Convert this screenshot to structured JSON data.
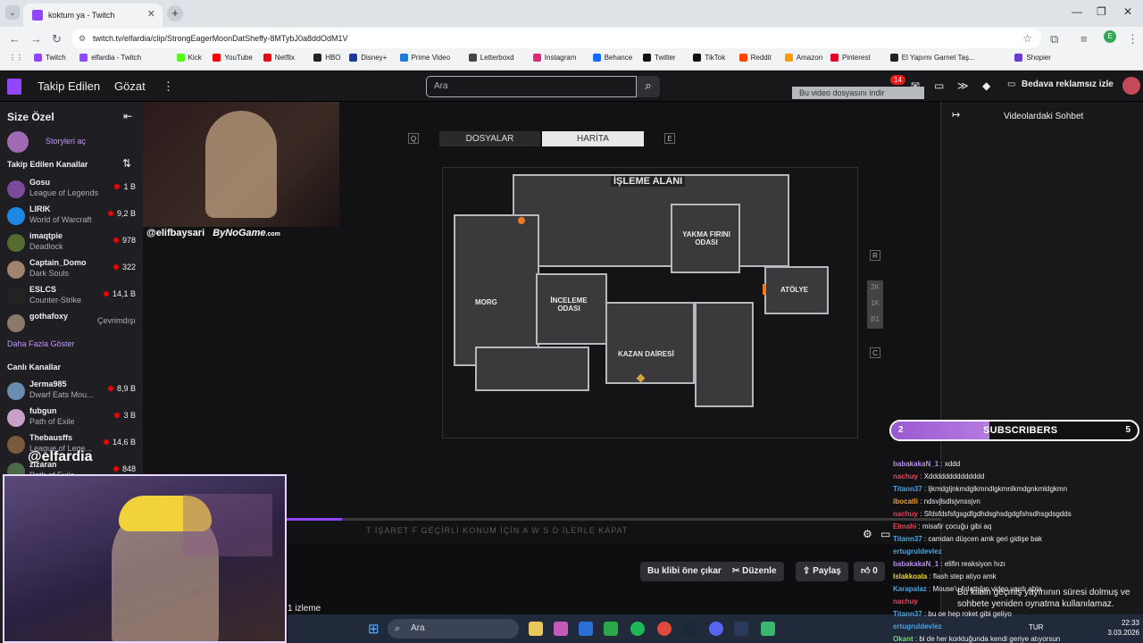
{
  "browser": {
    "tab_title": "koktum ya - Twitch",
    "url": "twitch.tv/elfardia/clip/StrongEagerMoonDatSheffy-8MTybJ0a8ddOdM1V",
    "bookmarks": [
      "Twitch",
      "elfardia - Twitch",
      "Kick",
      "YouTube",
      "Netflix",
      "HBO",
      "Disney+",
      "Prime Video",
      "Letterboxd",
      "Instagram",
      "Behance",
      "Twitter",
      "TikTok",
      "Reddit",
      "Amazon",
      "Pinterest",
      "El Yapımı Garnet Taş...",
      "Shopier"
    ],
    "bookmark_colors": [
      "#9146ff",
      "#9146ff",
      "#53fc18",
      "#ff0000",
      "#e50914",
      "#222222",
      "#1a3b9c",
      "#1f7ae0",
      "#444444",
      "#dd2a7b",
      "#1769ff",
      "#111111",
      "#111111",
      "#ff4500",
      "#ff9900",
      "#e60023",
      "#222222",
      "#6a3cd6"
    ],
    "profile_letter": "E"
  },
  "topnav": {
    "following": "Takip Edilen",
    "browse": "Gözat",
    "more": "⋮",
    "search_placeholder": "Ara",
    "notif_count": "14",
    "ad_free": "Bedava reklamsız izle"
  },
  "sidebar": {
    "for_you": "Size Özel",
    "stories": "Storyleri aç",
    "followed_title": "Takip Edilen Kanallar",
    "followed": [
      {
        "name": "Gosu",
        "game": "League of Legends",
        "viewers": "1 B",
        "color": "#7b4a9a"
      },
      {
        "name": "LIRIK",
        "game": "World of Warcraft",
        "viewers": "9,2 B",
        "color": "#1e88e5"
      },
      {
        "name": "imaqtpie",
        "game": "Deadlock",
        "viewers": "978",
        "color": "#556b2f"
      },
      {
        "name": "Captain_Domo",
        "game": "Dark Souls",
        "viewers": "322",
        "color": "#a0826d"
      },
      {
        "name": "ESLCS",
        "game": "Counter-Strike",
        "viewers": "14,1 B",
        "color": "#222222"
      },
      {
        "name": "gothafoxy",
        "game": "",
        "viewers": "",
        "status": "Çevrimdışı",
        "color": "#8a7a6a"
      }
    ],
    "show_more": "Daha Fazla Göster",
    "live_title": "Canlı Kanallar",
    "live": [
      {
        "name": "Jerma985",
        "game": "Dwarf Eats Mou...",
        "viewers": "8,9 B",
        "color": "#6a8caf"
      },
      {
        "name": "fubgun",
        "game": "Path of Exile",
        "viewers": "3 B",
        "color": "#c8a0c8"
      },
      {
        "name": "Thebausffs",
        "game": "League of Lege...",
        "viewers": "14,6 B",
        "color": "#7a5a3a"
      },
      {
        "name": "zizaran",
        "game": "Path of Exile",
        "viewers": "848",
        "color": "#4a6a4a"
      }
    ]
  },
  "game": {
    "tab_files": "DOSYALAR",
    "tab_map": "HARİTA",
    "key_left": "Q",
    "key_right": "E",
    "key_r": "R",
    "key_c": "C",
    "floors": [
      "2K",
      "1K",
      "B1"
    ],
    "rooms": {
      "processing": "İŞLEME ALANI",
      "furnace": "YAKMA FIRINI ODASI",
      "morgue": "MORG",
      "exam": "İNCELEME ODASI",
      "workshop": "ATÖLYE",
      "boiler": "KAZAN DAİRESİ"
    },
    "hints": "T İŞARET  F GEÇİRLİ KONUM İÇİN  A W S D İLERLE  KAPAT",
    "overlay_handle": "@elifbaysari",
    "overlay_brand": "ByNoGame",
    "overlay_domain": ".com"
  },
  "clip_actions": {
    "feature": "Bu klibi öne çıkar",
    "edit": "Düzenle",
    "share": "Paylaş",
    "likes": "0"
  },
  "views_text": "1 izleme",
  "download_notice": "Bu video dosyasını indir",
  "chat": {
    "title": "Videolardaki Sohbet",
    "expired": "Bu klibin geçmiş yayınının süresi dolmuş ve sohbete yeniden oynatma kullanılamaz.",
    "messages": [
      {
        "user": "babakakaN_1",
        "text": "xddd",
        "color": "#b58cf0"
      },
      {
        "user": "nachuy",
        "text": "Xdddddddddddddd",
        "color": "#e0455a"
      },
      {
        "user": "Titann37",
        "text": "ljkmdgljnkmdglkmndlgkmnlkmdgnkmldgkmn",
        "color": "#4aa3df"
      },
      {
        "user": "ibocatli",
        "text": "ndsvjlsdlsjvnssjvn",
        "color": "#f0a030"
      },
      {
        "user": "nachuy",
        "text": "Sfdsfdsfsfgsgdfgdhdsghsdgdgfshsdhsgdsgdds",
        "color": "#e0455a"
      },
      {
        "user": "Elmahi",
        "text": "misafir çocuğu gibi aq",
        "color": "#e0455a"
      },
      {
        "user": "Titann37",
        "text": "camdan düşcen amk geri gidişe bak",
        "color": "#4aa3df"
      },
      {
        "user": "ertugruldevlez",
        "text": "",
        "color": "#4aa3df"
      },
      {
        "user": "babakakaN_1",
        "text": "elifin reaksiyon hızı",
        "color": "#b58cf0"
      },
      {
        "user": "Islakkoala",
        "text": "flash step atiyo amk",
        "color": "#e6d23a"
      },
      {
        "user": "Karapalaz",
        "text": "Mouse'u fırlattığın video yardı abla",
        "color": "#4aa3df"
      },
      {
        "user": "nachuy",
        "text": "",
        "color": "#e0455a"
      },
      {
        "user": "Titann37",
        "text": "bu oe hep roket gibi geliyo",
        "color": "#4aa3df"
      },
      {
        "user": "ertugruldevlez",
        "text": "",
        "color": "#4aa3df"
      },
      {
        "user": "Okant",
        "text": "bi de her korktuğunda kendi geriye atıyorsun",
        "color": "#7ad07a"
      }
    ]
  },
  "subs_overlay": {
    "left": "2",
    "label": "SUBSCRIBERS",
    "right": "5",
    "progress": 0.4
  },
  "stream_overlay": {
    "name": "@elfardia"
  },
  "taskbar": {
    "search": "Ara",
    "lang": "TUR",
    "time": "22:33",
    "date": "3.03.2026"
  },
  "video_progress": 0.25
}
